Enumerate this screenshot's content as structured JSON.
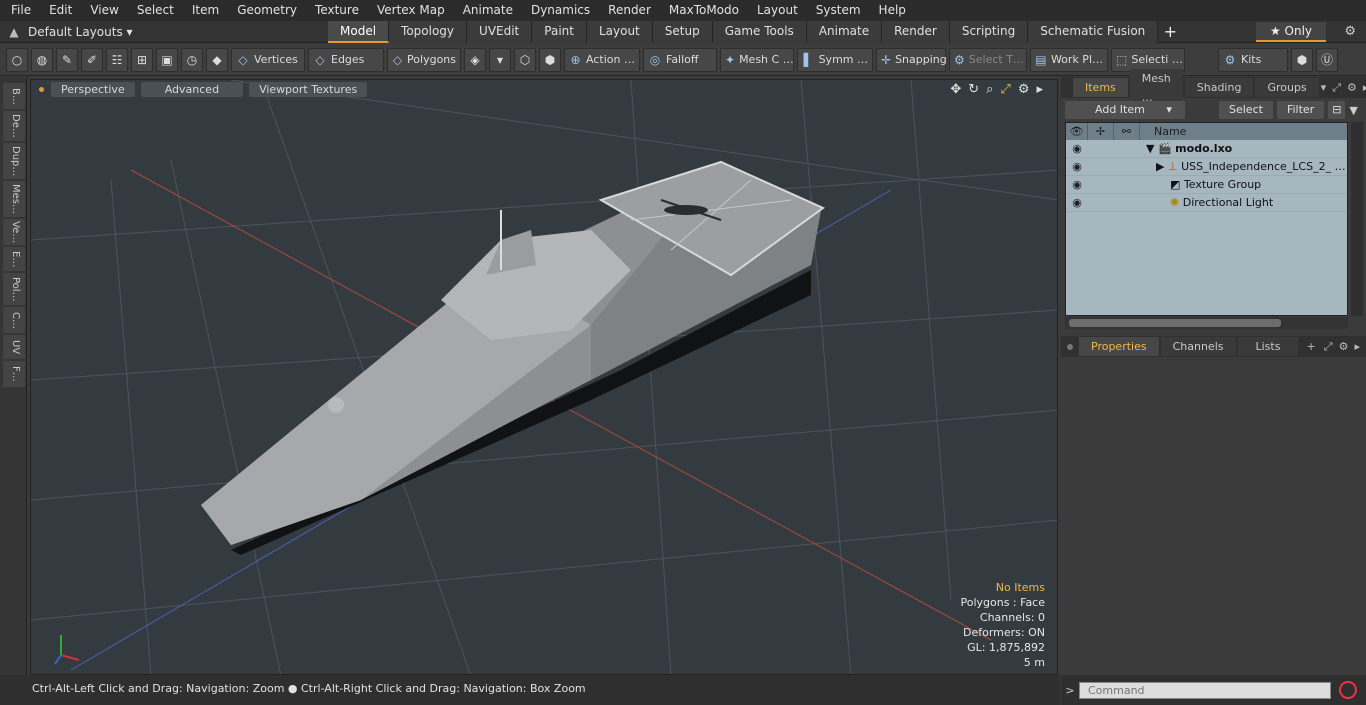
{
  "menu": [
    "File",
    "Edit",
    "View",
    "Select",
    "Item",
    "Geometry",
    "Texture",
    "Vertex Map",
    "Animate",
    "Dynamics",
    "Render",
    "MaxToModo",
    "Layout",
    "System",
    "Help"
  ],
  "layout_dropdown": "Default Layouts ▾",
  "layout_tabs": [
    {
      "label": "Model",
      "active": true
    },
    {
      "label": "Topology"
    },
    {
      "label": "UVEdit"
    },
    {
      "label": "Paint"
    },
    {
      "label": "Layout"
    },
    {
      "label": "Setup"
    },
    {
      "label": "Game Tools"
    },
    {
      "label": "Animate"
    },
    {
      "label": "Render"
    },
    {
      "label": "Scripting"
    },
    {
      "label": "Schematic Fusion"
    }
  ],
  "only_button": "★  Only",
  "toolbar": {
    "vertices": "Vertices",
    "edges": "Edges",
    "polygons": "Polygons",
    "action": "Action  …",
    "falloff": "Falloff",
    "mesh": "Mesh C …",
    "symm": "Symm …",
    "snapping": "Snapping",
    "select_t": "Select T…",
    "workplane": "Work Pl…",
    "selecti": "Selecti …",
    "kits": "Kits"
  },
  "left_tabs": [
    "B…",
    "De…",
    "Dup…",
    "Mes…",
    "Ve…",
    "E…",
    "Pol…",
    "C…",
    "UV",
    "F…"
  ],
  "viewport": {
    "perspective": "Perspective",
    "advanced": "Advanced",
    "viewport_textures": "Viewport Textures",
    "info": {
      "no_items": "No Items",
      "polygons": "Polygons : Face",
      "channels": "Channels: 0",
      "deformers": "Deformers: ON",
      "gl": "GL: 1,875,892",
      "scale": "5 m"
    }
  },
  "items_panel": {
    "tabs": [
      {
        "label": "Items",
        "active": true
      },
      {
        "label": "Mesh …"
      },
      {
        "label": "Shading"
      },
      {
        "label": "Groups"
      }
    ],
    "add_item": "Add Item",
    "select": "Select",
    "filter": "Filter",
    "col_name": "Name",
    "rows": [
      {
        "name": "modo.lxo",
        "bold": true
      },
      {
        "name": "USS_Independence_LCS_2_ …"
      },
      {
        "name": "Texture Group"
      },
      {
        "name": "Directional Light"
      }
    ]
  },
  "props_panel": {
    "tabs": [
      {
        "label": "Properties",
        "active": true
      },
      {
        "label": "Channels"
      },
      {
        "label": "Lists"
      }
    ]
  },
  "status": "Ctrl-Alt-Left Click and Drag: Navigation: Zoom ● Ctrl-Alt-Right Click and Drag: Navigation: Box Zoom",
  "command_placeholder": "Command",
  "colors": {
    "accent": "#e49a2f",
    "viewport_bg": "#333b40",
    "items_bg": "#a7b7c0"
  }
}
